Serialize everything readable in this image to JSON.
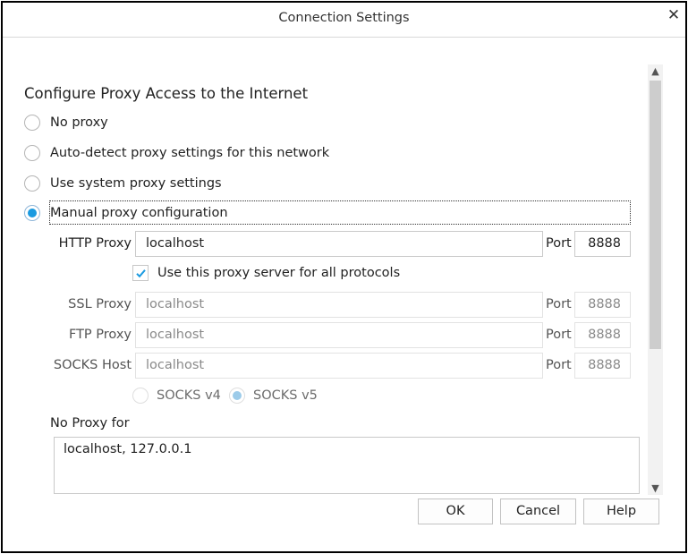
{
  "window": {
    "title": "Connection Settings",
    "close_glyph": "✕"
  },
  "heading": "Configure Proxy Access to the Internet",
  "proxy_options": [
    {
      "label": "No proxy",
      "checked": false
    },
    {
      "label": "Auto-detect proxy settings for this network",
      "checked": false
    },
    {
      "label": "Use system proxy settings",
      "checked": false
    },
    {
      "label": "Manual proxy configuration",
      "checked": true
    }
  ],
  "http": {
    "label": "HTTP Proxy",
    "value": "localhost",
    "port_label": "Port",
    "port": "8888"
  },
  "use_all_protocols": {
    "label": "Use this proxy server for all protocols",
    "checked": true
  },
  "ssl": {
    "label": "SSL Proxy",
    "value": "localhost",
    "port_label": "Port",
    "port": "8888"
  },
  "ftp": {
    "label": "FTP Proxy",
    "value": "localhost",
    "port_label": "Port",
    "port": "8888"
  },
  "socks": {
    "label": "SOCKS Host",
    "value": "localhost",
    "port_label": "Port",
    "port": "8888"
  },
  "socks_versions": [
    {
      "label": "SOCKS v4",
      "checked": false
    },
    {
      "label": "SOCKS v5",
      "checked": true
    }
  ],
  "no_proxy": {
    "label": "No Proxy for",
    "value": "localhost, 127.0.0.1"
  },
  "buttons": {
    "ok": "OK",
    "cancel": "Cancel",
    "help": "Help"
  },
  "colors": {
    "accent": "#1a9ae0",
    "border": "#c9c9c9"
  },
  "icons": {
    "close": "close-icon",
    "check": "checkmark-icon",
    "scroll_up": "chevron-up-icon",
    "scroll_down": "chevron-down-icon"
  }
}
